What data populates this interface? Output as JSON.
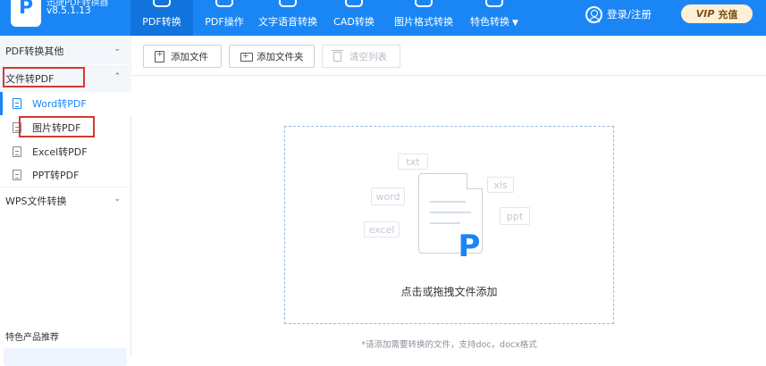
{
  "app": {
    "name": "迅捷PDF转换器",
    "version": "v8.5.1.13"
  },
  "nav": {
    "tabs": [
      {
        "label": "PDF转换"
      },
      {
        "label": "PDF操作"
      },
      {
        "label": "文字语音转换"
      },
      {
        "label": "CAD转换"
      },
      {
        "label": "图片格式转换"
      },
      {
        "label": "特色转换"
      }
    ],
    "caret": "▼",
    "login": "登录/注册",
    "vip": {
      "badge": "VIP",
      "label": "充值"
    }
  },
  "sidebar": {
    "groups": [
      {
        "label": "PDF转换其他",
        "chevron": "⌄"
      },
      {
        "label": "文件转PDF",
        "chevron": "⌃"
      },
      {
        "label": "WPS文件转换",
        "chevron": "⌄"
      }
    ],
    "items": [
      {
        "label": "Word转PDF"
      },
      {
        "label": "图片转PDF"
      },
      {
        "label": "Excel转PDF"
      },
      {
        "label": "PPT转PDF"
      }
    ],
    "promo_title": "特色产品推荐"
  },
  "toolbar": {
    "add_file": "添加文件",
    "add_folder": "添加文件夹",
    "clear_list": "清空列表"
  },
  "dropzone": {
    "ghost_labels": [
      "txt",
      "word",
      "xls",
      "ppt",
      "excel"
    ],
    "logo_letter": "P",
    "text": "点击或拖拽文件添加",
    "hint": "*请添加需要转换的文件，支持doc，docx格式"
  },
  "colors": {
    "accent": "#1a86f5",
    "highlight_box": "#d33a32"
  }
}
